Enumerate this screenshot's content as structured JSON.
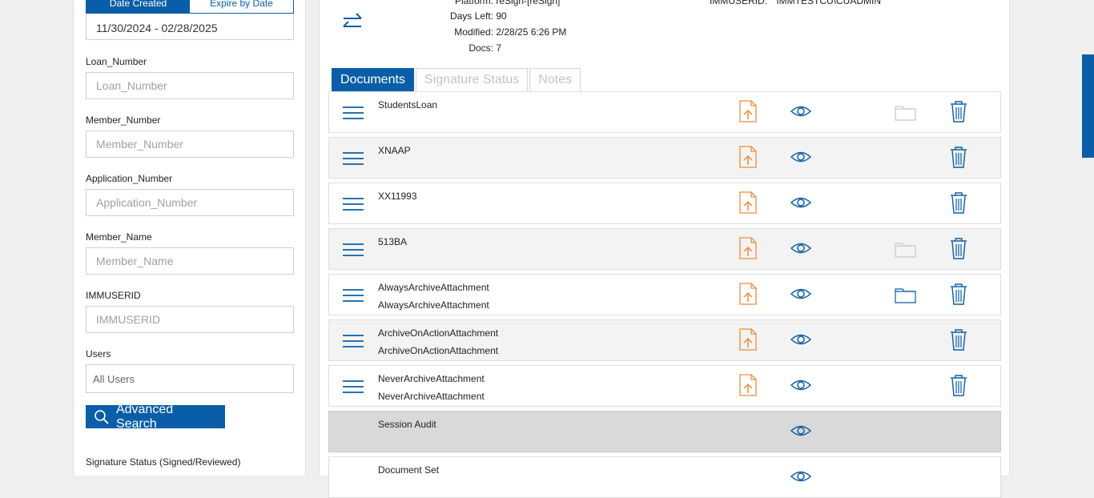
{
  "search": {
    "date_tabs": [
      "Date Created",
      "Expire by Date"
    ],
    "date_range": "11/30/2024 - 02/28/2025",
    "fields": [
      {
        "label": "Loan_Number",
        "placeholder": "Loan_Number"
      },
      {
        "label": "Member_Number",
        "placeholder": "Member_Number"
      },
      {
        "label": "Application_Number",
        "placeholder": "Application_Number"
      },
      {
        "label": "Member_Name",
        "placeholder": "Member_Name"
      },
      {
        "label": "IMMUSERID",
        "placeholder": "IMMUSERID"
      }
    ],
    "users_label": "Users",
    "users_value": "All Users",
    "advanced_search_label": "Advanced Search",
    "signature_status_label": "Signature Status (Signed/Reviewed)"
  },
  "header": {
    "platform_key": "Platform:",
    "platform_value": "reSign-[reSign]",
    "days_left_key": "Days Left:",
    "days_left_value": "90",
    "modified_key": "Modified:",
    "modified_value": "2/28/25 6:26 PM",
    "docs_key": "Docs:",
    "docs_value": "7",
    "immuserid_key": "IMMUSERID:",
    "immuserid_value": "IMMTESTCU\\CUADMIN"
  },
  "tabs": [
    "Documents",
    "Signature Status",
    "Notes"
  ],
  "documents": [
    {
      "name": "StudentsLoan",
      "sub": "",
      "folder": "light"
    },
    {
      "name": "XNAAP",
      "sub": "",
      "folder": "none"
    },
    {
      "name": "XX11993",
      "sub": "",
      "folder": "none"
    },
    {
      "name": "513BA",
      "sub": "",
      "folder": "light"
    },
    {
      "name": "AlwaysArchiveAttachment",
      "sub": "AlwaysArchiveAttachment",
      "folder": "blue"
    },
    {
      "name": "ArchiveOnActionAttachment",
      "sub": "ArchiveOnActionAttachment",
      "folder": "none"
    },
    {
      "name": "NeverArchiveAttachment",
      "sub": "NeverArchiveAttachment",
      "folder": "none"
    }
  ],
  "session_audit_label": "Session Audit",
  "document_set_label": "Document Set",
  "colors": {
    "accent": "#0a5ea8",
    "upload": "#f08c3c",
    "folder_light": "#c9c9c9",
    "row_alt": "#f3f3f3",
    "audit_row": "#d9d9d9"
  }
}
